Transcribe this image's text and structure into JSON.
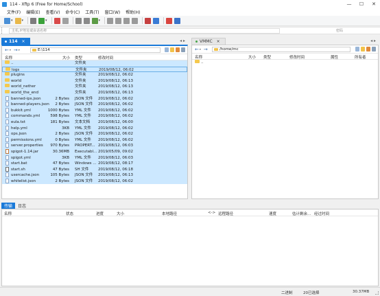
{
  "window": {
    "title": "114 - Xftp 6 (Free for Home/School)",
    "minimize": "—",
    "maximize": "☐",
    "close": "✕"
  },
  "menu": [
    "文件(F)",
    "编辑(E)",
    "查看(V)",
    "命令(C)",
    "工具(T)",
    "窗口(W)",
    "帮助(H)"
  ],
  "toolbar": {
    "buttons": [
      {
        "icon": "new-session-icon",
        "color": "#4a8fd6"
      },
      {
        "icon": "open-folder-icon",
        "color": "#e9b84a"
      },
      {
        "icon": "properties-icon",
        "color": "#7d7d7d"
      },
      {
        "icon": "refresh-icon",
        "color": "#3aa13a"
      },
      {
        "icon": "new-folder-icon",
        "color": "#d94a4a"
      },
      {
        "icon": "sync-icon",
        "color": "#a0a0a0"
      },
      {
        "icon": "left-arrow-icon",
        "color": "#8a8a8a"
      },
      {
        "icon": "right-arrow-icon",
        "color": "#8a8a8a"
      },
      {
        "icon": "transfer-icon",
        "color": "#5c9b45"
      },
      {
        "icon": "copy-icon",
        "color": "#9a9a9a"
      },
      {
        "icon": "paste-icon",
        "color": "#9a9a9a"
      },
      {
        "icon": "delete-icon",
        "color": "#9a9a9a"
      },
      {
        "icon": "disconnect-icon",
        "color": "#9a9a9a"
      },
      {
        "icon": "xshell-icon",
        "color": "#c64040"
      },
      {
        "icon": "xmanager-icon",
        "color": "#3a7bd5"
      },
      {
        "icon": "stop-icon",
        "color": "#d9453f"
      },
      {
        "icon": "help-icon",
        "color": "#3b73c9"
      }
    ]
  },
  "addressbar": {
    "placeholder": "主机,IP地址或会话名称",
    "hint": "密码"
  },
  "left_tab": {
    "label": "114",
    "close": "×"
  },
  "right_tab": {
    "label": "VMMC",
    "close": "×"
  },
  "tab_arrows": "◂ ▸",
  "left_panel": {
    "path": "E:\\114",
    "columns": {
      "name": "名称",
      "size": "大小",
      "type": "类型",
      "modified": "修改时间"
    },
    "files": [
      {
        "name": "..",
        "size": "",
        "type": "文件夹",
        "modified": "",
        "kind": "folder"
      },
      {
        "name": "logs",
        "size": "",
        "type": "文件夹",
        "modified": "2019/08/12, 06:02",
        "kind": "folder"
      },
      {
        "name": "plugins",
        "size": "",
        "type": "文件夹",
        "modified": "2019/08/12, 06:02",
        "kind": "folder"
      },
      {
        "name": "world",
        "size": "",
        "type": "文件夹",
        "modified": "2019/08/12, 06:13",
        "kind": "folder"
      },
      {
        "name": "world_nether",
        "size": "",
        "type": "文件夹",
        "modified": "2019/08/12, 06:13",
        "kind": "folder"
      },
      {
        "name": "world_the_end",
        "size": "",
        "type": "文件夹",
        "modified": "2019/08/12, 06:13",
        "kind": "folder"
      },
      {
        "name": "banned-ips.json",
        "size": "2 Bytes",
        "type": "JSON 文件",
        "modified": "2019/08/12, 06:02",
        "kind": "file"
      },
      {
        "name": "banned-players.json",
        "size": "2 Bytes",
        "type": "JSON 文件",
        "modified": "2019/08/12, 06:02",
        "kind": "file"
      },
      {
        "name": "bukkit.yml",
        "size": "1000 Bytes",
        "type": "YML 文件",
        "modified": "2019/08/12, 06:02",
        "kind": "file"
      },
      {
        "name": "commands.yml",
        "size": "598 Bytes",
        "type": "YML 文件",
        "modified": "2019/08/12, 06:02",
        "kind": "file"
      },
      {
        "name": "eula.txt",
        "size": "181 Bytes",
        "type": "文本文档",
        "modified": "2019/08/12, 06:00",
        "kind": "file"
      },
      {
        "name": "help.yml",
        "size": "3KB",
        "type": "YML 文件",
        "modified": "2019/08/12, 06:02",
        "kind": "file"
      },
      {
        "name": "ops.json",
        "size": "2 Bytes",
        "type": "JSON 文件",
        "modified": "2019/08/12, 06:02",
        "kind": "file"
      },
      {
        "name": "permissions.yml",
        "size": "0 Bytes",
        "type": "YML 文件",
        "modified": "2019/08/12, 06:02",
        "kind": "file"
      },
      {
        "name": "server.properties",
        "size": "970 Bytes",
        "type": "PROPERT...",
        "modified": "2019/08/12, 06:03",
        "kind": "file"
      },
      {
        "name": "spigot-1.14.jar",
        "size": "30.36MB",
        "type": "Executabl...",
        "modified": "2019/05/09, 09:02",
        "kind": "jar"
      },
      {
        "name": "spigot.yml",
        "size": "3KB",
        "type": "YML 文件",
        "modified": "2019/08/12, 06:03",
        "kind": "file"
      },
      {
        "name": "start.bat",
        "size": "47 Bytes",
        "type": "Windows ...",
        "modified": "2019/08/12, 08:17",
        "kind": "file"
      },
      {
        "name": "start.sh",
        "size": "47 Bytes",
        "type": "SH 文件",
        "modified": "2019/08/12, 06:18",
        "kind": "sh"
      },
      {
        "name": "usercache.json",
        "size": "105 Bytes",
        "type": "JSON 文件",
        "modified": "2019/08/12, 06:13",
        "kind": "file"
      },
      {
        "name": "whitelist.json",
        "size": "2 Bytes",
        "type": "JSON 文件",
        "modified": "2019/08/12, 06:02",
        "kind": "file"
      }
    ]
  },
  "right_panel": {
    "path": "/home/mc",
    "columns": {
      "name": "名称",
      "size": "大小",
      "type": "类型",
      "modified": "修改时间",
      "attr": "属性",
      "owner": "所有者"
    },
    "files": [
      {
        "name": "..",
        "kind": "folder"
      }
    ]
  },
  "log_tabs": [
    "传输",
    "日志"
  ],
  "transfer": {
    "columns": [
      "名称",
      "状态",
      "进度",
      "大小",
      "本地路径",
      "<->",
      "远程路径",
      "速度",
      "估计剩余...",
      "经过时间"
    ]
  },
  "status": {
    "mode": "二进制",
    "count": "20已选择",
    "size": "30.37MB"
  }
}
